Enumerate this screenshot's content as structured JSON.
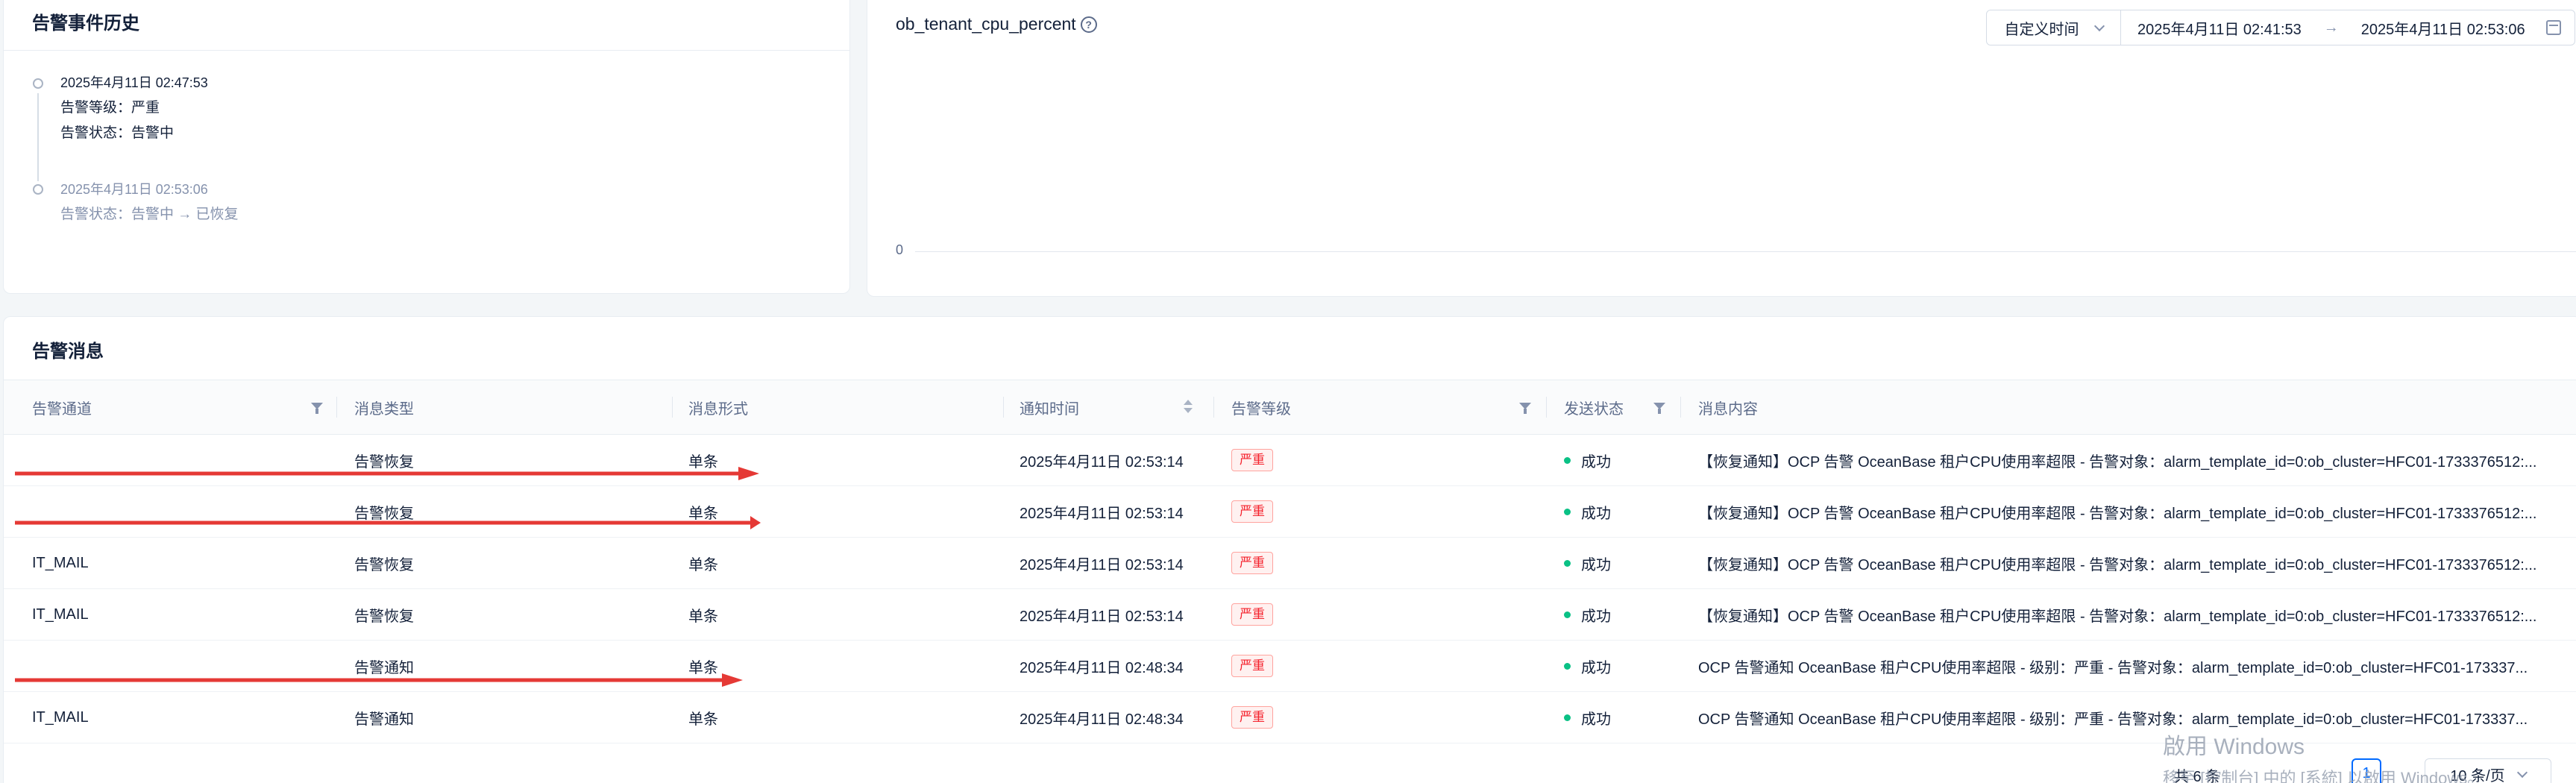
{
  "history": {
    "title": "告警事件历史",
    "events": [
      {
        "time": "2025年4月11日 02:47:53",
        "lines": [
          "告警等级：严重",
          "告警状态：告警中"
        ]
      },
      {
        "time": "2025年4月11日 02:53:06",
        "lines": [
          "告警状态：告警中 → 已恢复"
        ]
      }
    ]
  },
  "chart": {
    "metric": "ob_tenant_cpu_percent",
    "help_icon": "question-circle-icon",
    "range_mode": "自定义时间",
    "range_start": "2025年4月11日 02:41:53",
    "range_arrow": "→",
    "range_end": "2025年4月11日 02:53:06",
    "y_zero_label": "0"
  },
  "chart_data": {
    "type": "line",
    "title": "ob_tenant_cpu_percent",
    "series": [],
    "y_ticks": [
      "0"
    ]
  },
  "messages": {
    "title": "告警消息",
    "columns": [
      "告警通道",
      "消息类型",
      "消息形式",
      "通知时间",
      "告警等级",
      "发送状态",
      "消息内容"
    ],
    "rows": [
      {
        "channel": "",
        "type": "告警恢复",
        "form": "单条",
        "time": "2025年4月11日 02:53:14",
        "level": "严重",
        "status": "成功",
        "content": "【恢复通知】OCP 告警 OceanBase 租户CPU使用率超限 - 告警对象：alarm_template_id=0:ob_cluster=HFC01-1733376512:..."
      },
      {
        "channel": "",
        "type": "告警恢复",
        "form": "单条",
        "time": "2025年4月11日 02:53:14",
        "level": "严重",
        "status": "成功",
        "content": "【恢复通知】OCP 告警 OceanBase 租户CPU使用率超限 - 告警对象：alarm_template_id=0:ob_cluster=HFC01-1733376512:..."
      },
      {
        "channel": "IT_MAIL",
        "type": "告警恢复",
        "form": "单条",
        "time": "2025年4月11日 02:53:14",
        "level": "严重",
        "status": "成功",
        "content": "【恢复通知】OCP 告警 OceanBase 租户CPU使用率超限 - 告警对象：alarm_template_id=0:ob_cluster=HFC01-1733376512:..."
      },
      {
        "channel": "IT_MAIL",
        "type": "告警恢复",
        "form": "单条",
        "time": "2025年4月11日 02:53:14",
        "level": "严重",
        "status": "成功",
        "content": "【恢复通知】OCP 告警 OceanBase 租户CPU使用率超限 - 告警对象：alarm_template_id=0:ob_cluster=HFC01-1733376512:..."
      },
      {
        "channel": "",
        "type": "告警通知",
        "form": "单条",
        "time": "2025年4月11日 02:48:34",
        "level": "严重",
        "status": "成功",
        "content": "OCP 告警通知 OceanBase 租户CPU使用率超限 - 级别：严重 - 告警对象：alarm_template_id=0:ob_cluster=HFC01-173337..."
      },
      {
        "channel": "IT_MAIL",
        "type": "告警通知",
        "form": "单条",
        "time": "2025年4月11日 02:48:34",
        "level": "严重",
        "status": "成功",
        "content": "OCP 告警通知 OceanBase 租户CPU使用率超限 - 级别：严重 - 告警对象：alarm_template_id=0:ob_cluster=HFC01-173337..."
      }
    ],
    "pagination": {
      "total": "共 6 条",
      "page": "1",
      "page_size": "10 条/页"
    }
  },
  "annotations": {
    "arrow_color": "#e53935"
  },
  "watermark": {
    "line1": "啟用 Windows",
    "line2": "移至 [控制台] 中的 [系統] 以啟用 Windows。"
  },
  "colors": {
    "danger": "#f5222d",
    "success": "#0ac185",
    "primary": "#006aff"
  }
}
